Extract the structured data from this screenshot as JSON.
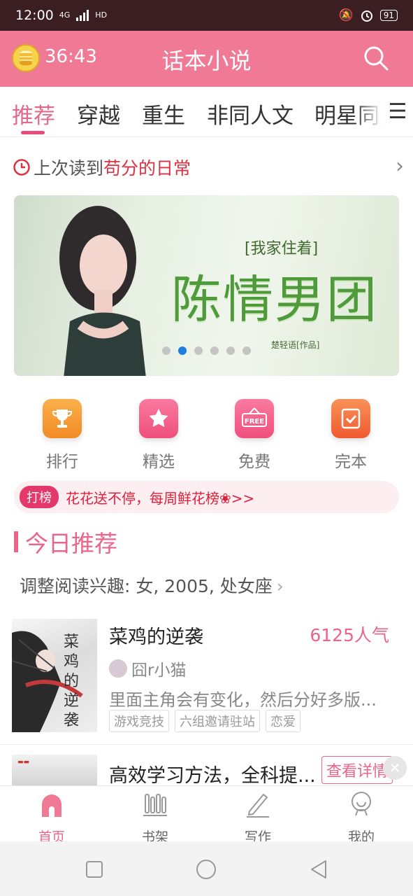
{
  "status_bar": {
    "time": "12:00",
    "network": "4G",
    "hd": "HD",
    "battery": "91"
  },
  "app_bar": {
    "timer": "36:43",
    "title": "话本小说"
  },
  "tabs": [
    "推荐",
    "穿越",
    "重生",
    "非同人文",
    "明星同人"
  ],
  "last_read": {
    "prefix": "上次读到",
    "book": "苟分的日常"
  },
  "banner": {
    "subtitle": "[我家住着]",
    "title": "陈情男团",
    "author": "楚轻语[作品]",
    "pages": 6,
    "active_index": 1
  },
  "quick_nav": [
    {
      "label": "排行",
      "icon": "trophy-icon",
      "color": "#f7952f"
    },
    {
      "label": "精选",
      "icon": "star-icon",
      "color": "#f25a85"
    },
    {
      "label": "免费",
      "icon": "free-sign-icon",
      "color": "#f25a85"
    },
    {
      "label": "完本",
      "icon": "check-book-icon",
      "color": "#f4713c"
    }
  ],
  "promo": {
    "badge": "打榜",
    "text": "花花送不停，每周鲜花榜❀>>"
  },
  "section": {
    "title": "今日推荐",
    "interest": "调整阅读兴趣: 女, 2005, 处女座"
  },
  "books": [
    {
      "title": "菜鸡的逆袭",
      "popularity": "6125人气",
      "author": "囧r小猫",
      "description": "里面主角会有变化，然后分好多版...",
      "tags": [
        "游戏竞技",
        "六组邀请驻站",
        "恋爱"
      ],
      "cover_text": "菜鸡的逆袭"
    },
    {
      "title": "高效学习方法，全科提...",
      "action": "查看详情"
    }
  ],
  "bottom_tabs": [
    {
      "label": "首页",
      "icon": "home-icon",
      "active": true
    },
    {
      "label": "书架",
      "icon": "bookshelf-icon",
      "active": false
    },
    {
      "label": "写作",
      "icon": "pencil-icon",
      "active": false
    },
    {
      "label": "我的",
      "icon": "profile-icon",
      "active": false
    }
  ],
  "colors": {
    "accent": "#f07a95",
    "pink_text": "#e9658a",
    "red_text": "#e0303f"
  }
}
